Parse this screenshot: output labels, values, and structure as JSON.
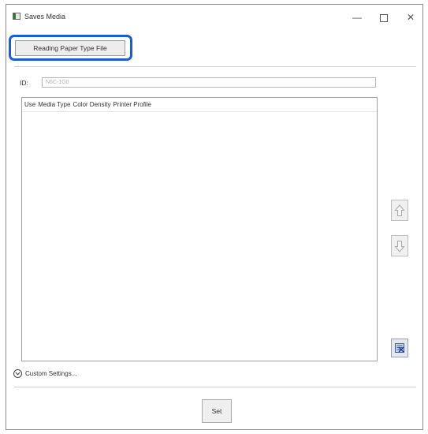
{
  "window": {
    "title": "Saves Media",
    "minimize_glyph": "—",
    "close_glyph": "✕"
  },
  "toolbar": {
    "reading_button_label": "Reading Paper Type File"
  },
  "id_section": {
    "label": "ID:",
    "value": "N6C-1G0"
  },
  "list": {
    "columns": [
      "Use",
      "Media Type",
      "Color Density",
      "Printer Profile"
    ]
  },
  "side_buttons": {
    "up": "arrow-up-icon",
    "down": "arrow-down-icon",
    "clear": "clear-list-icon"
  },
  "custom_settings": {
    "label": "Custom Settings..."
  },
  "footer": {
    "set_label": "Set"
  },
  "colors": {
    "highlight": "#1a5bd6",
    "border": "#9e9e9e"
  }
}
